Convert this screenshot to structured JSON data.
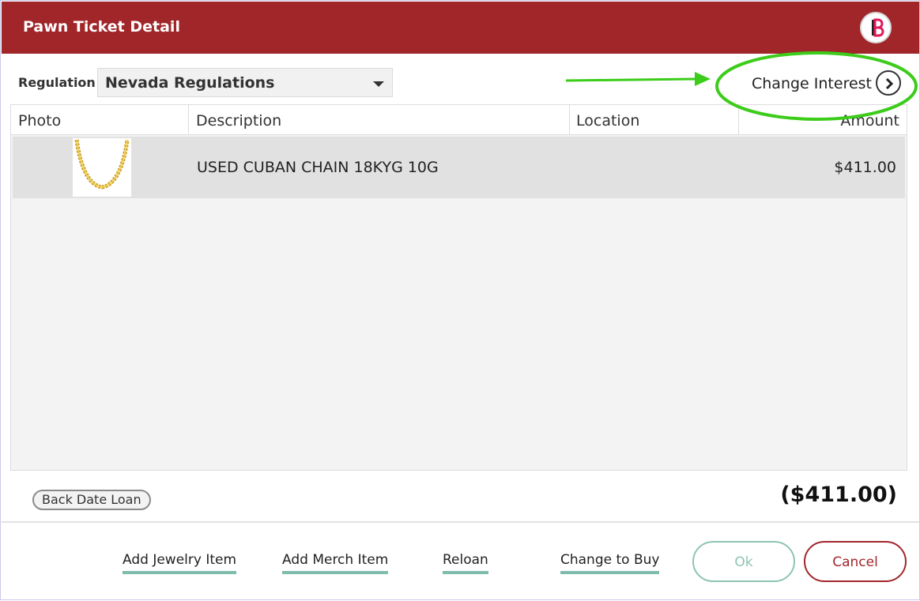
{
  "window": {
    "title": "Pawn Ticket Detail",
    "logo_letter": "B"
  },
  "regulation": {
    "label": "Regulation",
    "selected": "Nevada Regulations"
  },
  "change_interest": {
    "label": "Change Interest"
  },
  "table": {
    "columns": [
      "Photo",
      "Description",
      "Location",
      "Amount"
    ],
    "rows": [
      {
        "photo": "gold-chain-image",
        "description": "USED CUBAN CHAIN 18KYG 10G",
        "location": "",
        "amount": "$411.00"
      }
    ]
  },
  "footer": {
    "back_date_label": "Back Date Loan",
    "total": "($411.00)",
    "actions": [
      "Add Jewelry Item",
      "Add Merch Item",
      "Reloan",
      "Change to Buy"
    ],
    "ok_label": "Ok",
    "cancel_label": "Cancel"
  },
  "colors": {
    "header": "#a0262a",
    "accent_teal": "#7fbcab",
    "annotation": "#3ccc1a"
  }
}
